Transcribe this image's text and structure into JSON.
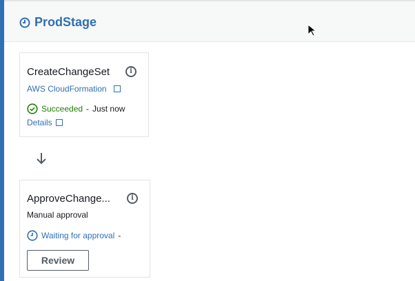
{
  "stage": {
    "title": "ProdStage"
  },
  "actions": [
    {
      "name": "CreateChangeSet",
      "provider": "AWS CloudFormation",
      "status": "Succeeded",
      "separator": "-",
      "time": "Just now",
      "details": "Details"
    },
    {
      "name": "ApproveChange...",
      "provider": "Manual approval",
      "status": "Waiting for approval",
      "separator": "-",
      "button": "Review"
    }
  ],
  "colors": {
    "accent": "#2f6fb3",
    "success": "#1d8102"
  }
}
